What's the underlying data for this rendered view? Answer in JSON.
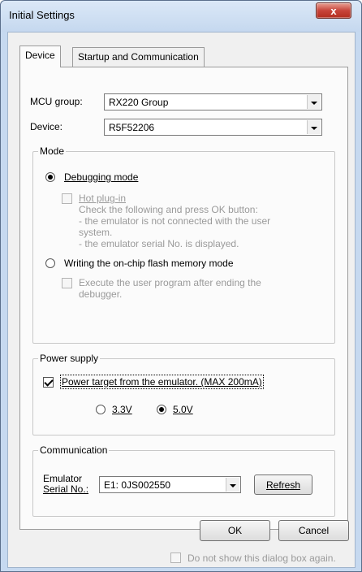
{
  "window": {
    "title": "Initial Settings",
    "close_symbol": "x"
  },
  "tabs": [
    {
      "label": "Device",
      "active": true
    },
    {
      "label": "Startup and Communication",
      "active": false
    }
  ],
  "device_tab": {
    "mcu_group_label": "MCU group:",
    "mcu_group_value": "RX220 Group",
    "device_label": "Device:",
    "device_value": "R5F52206",
    "mode": {
      "title": "Mode",
      "debugging_mode": "Debugging mode",
      "hot_plugin": "Hot plug-in",
      "hot_plugin_desc": [
        "Check the following and press OK button:",
        "- the emulator is not connected with the user",
        "system.",
        "- the emulator serial No. is displayed."
      ],
      "writing_mode": "Writing the on-chip flash memory mode",
      "execute_program": "Execute the user program after ending the",
      "execute_program_2": "debugger.",
      "selected": "debugging"
    },
    "power_supply": {
      "title": "Power supply",
      "power_target": "Power target from the emulator. (MAX 200mA)",
      "power_target_checked": true,
      "v33": "3.3V",
      "v50": "5.0V",
      "selected_voltage": "5.0V"
    },
    "communication": {
      "title": "Communication",
      "emulator_label_1": "Emulator",
      "emulator_label_2": "Serial No.:",
      "serial_value": "E1: 0JS002550",
      "refresh_button": "Refresh"
    }
  },
  "footer": {
    "ok_button": "OK",
    "cancel_button": "Cancel",
    "do_not_show": "Do not show this dialog box again."
  }
}
